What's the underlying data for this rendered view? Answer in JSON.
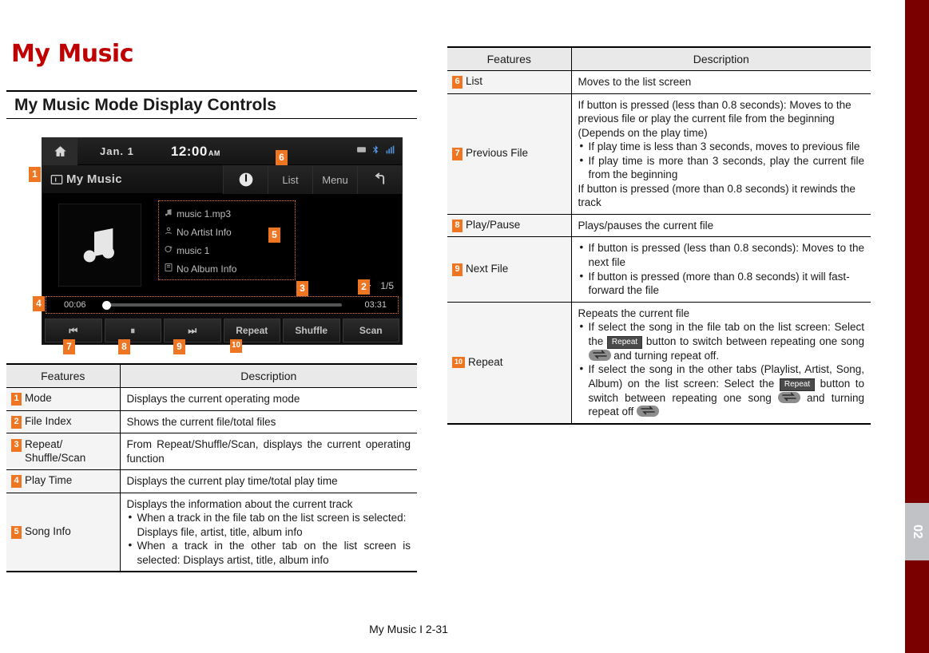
{
  "page": {
    "chapter_title": "My Music",
    "section_title": "My Music Mode Display Controls",
    "footer": "My Music I 2-31",
    "edge_tab_number": "02",
    "accent_orange": "#ee7623",
    "brand_red": "#c00000",
    "edge_tab_red": "#7a0000"
  },
  "head_unit": {
    "status": {
      "home_icon": "home-icon",
      "date": "Jan. 1",
      "time": "12:00",
      "ampm": "AM",
      "system_icons": [
        "card-icon",
        "bluetooth-icon",
        "signal-icon"
      ]
    },
    "title_bar": {
      "mode_icon": "my-music-icon",
      "mode_label": "My Music",
      "buttons": [
        "power-icon",
        "List",
        "Menu",
        "back-arrow-icon"
      ]
    },
    "song_info": [
      {
        "icon": "note-icon",
        "text": "music 1.mp3"
      },
      {
        "icon": "artist-icon",
        "text": "No Artist Info"
      },
      {
        "icon": "title-icon",
        "text": "music 1"
      },
      {
        "icon": "album-icon",
        "text": "No Album Info"
      }
    ],
    "meta": {
      "repeat_icon": "repeat-icon",
      "file_index": "1/5"
    },
    "progress": {
      "elapsed": "00:06",
      "total": "03:31"
    },
    "buttons": [
      {
        "name": "previous-file-button",
        "label": "⏮"
      },
      {
        "name": "play-pause-button",
        "label": "⏸"
      },
      {
        "name": "next-file-button",
        "label": "⏭"
      },
      {
        "name": "repeat-button",
        "label": "Repeat"
      },
      {
        "name": "shuffle-button",
        "label": "Shuffle"
      },
      {
        "name": "scan-button",
        "label": "Scan"
      }
    ],
    "callouts": [
      "1",
      "2",
      "3",
      "4",
      "5",
      "6",
      "7",
      "8",
      "9",
      "10"
    ]
  },
  "table_headers": {
    "features": "Features",
    "description": "Description"
  },
  "left_table": [
    {
      "num": "1",
      "feature": "Mode",
      "desc_lead": "Displays the current operating mode",
      "bullets": []
    },
    {
      "num": "2",
      "feature": "File Index",
      "desc_lead": "Shows the current file/total files",
      "bullets": []
    },
    {
      "num": "3",
      "feature": "Repeat/ Shuffle/Scan",
      "desc_lead": "From Repeat/Shuffle/Scan, displays the current operating function",
      "bullets": []
    },
    {
      "num": "4",
      "feature": "Play Time",
      "desc_lead": "Displays the current play time/total play time",
      "bullets": []
    },
    {
      "num": "5",
      "feature": "Song Info",
      "desc_lead": "Displays the information about the current track",
      "bullets": [
        "When a track in the file tab on the list screen is selected: Displays file, artist, title, album info",
        "When a track in the other tab on the list screen is selected: Displays artist, title, album info"
      ]
    }
  ],
  "right_table": [
    {
      "num": "6",
      "feature": "List",
      "desc_lead": "Moves to the list screen",
      "bullets": [],
      "desc_tail": ""
    },
    {
      "num": "7",
      "feature": "Previous File",
      "desc_lead": "If button is pressed (less than 0.8 seconds): Moves to the previous file or play the current file from the beginning (Depends on the play time)",
      "bullets": [
        "If play time is less than 3 seconds, moves to previous file",
        "If play time is more than 3 seconds, play the current file from the beginning"
      ],
      "desc_tail": "If button is pressed (more than 0.8 seconds) it rewinds the track"
    },
    {
      "num": "8",
      "feature": "Play/Pause",
      "desc_lead": "Plays/pauses the current file",
      "bullets": [],
      "desc_tail": ""
    },
    {
      "num": "9",
      "feature": "Next File",
      "desc_lead": "",
      "bullets": [
        "If button is pressed (less than 0.8 seconds): Moves to the next file",
        "If button is pressed (more than 0.8 seconds) it will fast-forward the file"
      ],
      "desc_tail": ""
    },
    {
      "num": "10",
      "feature": "Repeat",
      "desc_lead": "Repeats the current file",
      "bullets": [],
      "desc_tail": ""
    }
  ],
  "repeat_row_rich": {
    "bullet1_a": "If select the song in the file tab on the list screen: Select the",
    "bullet1_btn": "Repeat",
    "bullet1_b": "button to switch between repeating one song",
    "bullet1_ico": "repeat-one-icon",
    "bullet1_c": "and turning repeat off.",
    "bullet2_a": "If select the song in the other tabs (Playlist, Artist, Song, Album) on the list screen: Select the",
    "bullet2_btn": "Repeat",
    "bullet2_b": "button to switch between repeating one song",
    "bullet2_ico": "repeat-one-icon",
    "bullet2_c": "and turning repeat",
    "bullet2_d": "off",
    "bullet2_ico2": "repeat-off-icon"
  }
}
